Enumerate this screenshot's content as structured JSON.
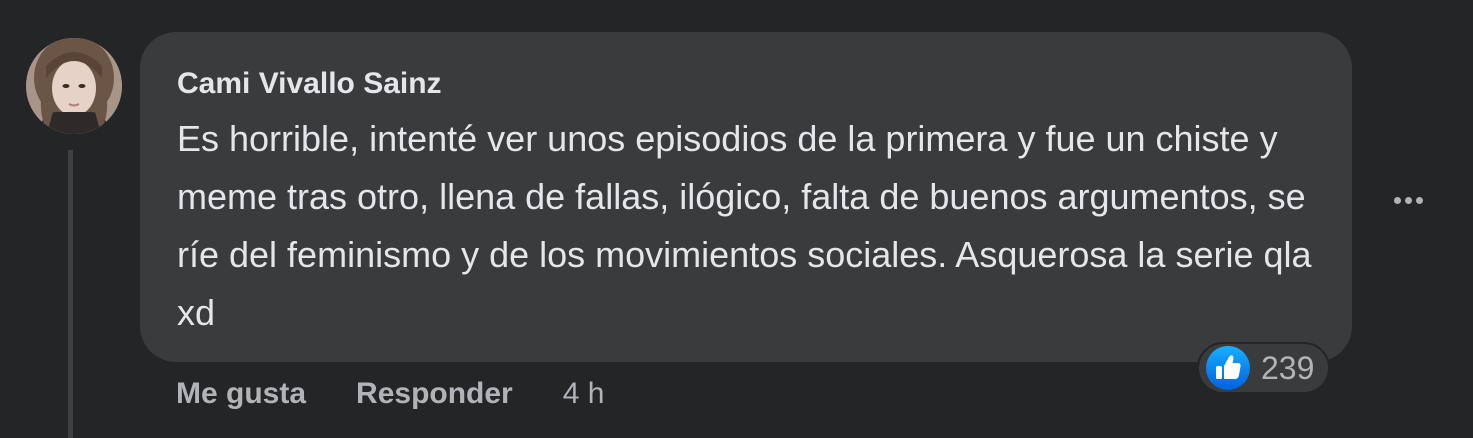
{
  "comment": {
    "author": "Cami Vivallo Sainz",
    "text": "Es horrible, intenté ver unos episodios de la primera y fue un chiste y meme tras otro, llena de fallas, ilógico, falta de buenos argumentos, se ríe del feminismo y de los movimientos sociales. Asquerosa la serie qla xd",
    "reactions": {
      "icon": "like-icon",
      "count": "239"
    },
    "actions": {
      "like_label": "Me gusta",
      "reply_label": "Responder",
      "timestamp": "4 h"
    },
    "more_icon": "more-options-icon"
  },
  "colors": {
    "background": "#242526",
    "bubble": "#3a3b3c",
    "primary_text": "#e4e6eb",
    "secondary_text": "#b0b3b8",
    "like_blue": "#1877f2"
  }
}
